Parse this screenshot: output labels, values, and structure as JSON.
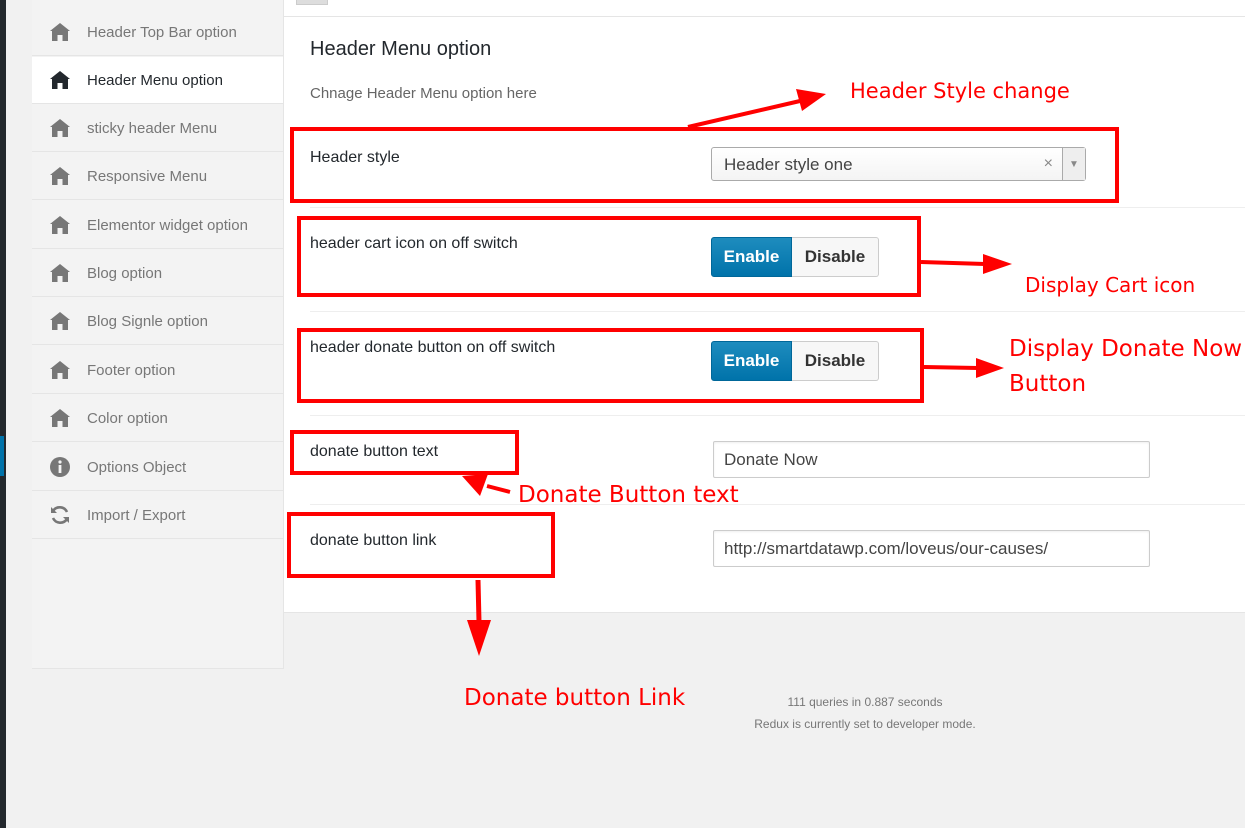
{
  "sidebar": {
    "items": [
      {
        "label": "Header Top Bar option",
        "icon": "home-icon",
        "active": false
      },
      {
        "label": "Header Menu option",
        "icon": "home-icon",
        "active": true
      },
      {
        "label": "sticky header Menu",
        "icon": "home-icon",
        "active": false
      },
      {
        "label": "Responsive Menu",
        "icon": "home-icon",
        "active": false
      },
      {
        "label": "Elementor widget option",
        "icon": "home-icon",
        "active": false
      },
      {
        "label": "Blog option",
        "icon": "home-icon",
        "active": false
      },
      {
        "label": "Blog Signle option",
        "icon": "home-icon",
        "active": false
      },
      {
        "label": "Footer option",
        "icon": "home-icon",
        "active": false
      },
      {
        "label": "Color option",
        "icon": "home-icon",
        "active": false
      },
      {
        "label": "Options Object",
        "icon": "info-icon",
        "active": false
      },
      {
        "label": "Import / Export",
        "icon": "refresh-icon",
        "active": false
      }
    ]
  },
  "section": {
    "title": "Header Menu option",
    "description": "Chnage Header Menu option here"
  },
  "fields": {
    "header_style": {
      "label": "Header style",
      "value": "Header style one",
      "clear": "×",
      "arrow": "▼"
    },
    "cart_switch": {
      "label": "header cart icon on off switch",
      "enable": "Enable",
      "disable": "Disable",
      "state": "enabled"
    },
    "donate_switch": {
      "label": "header donate button on off switch",
      "enable": "Enable",
      "disable": "Disable",
      "state": "enabled"
    },
    "donate_text": {
      "label": "donate button text",
      "value": "Donate Now"
    },
    "donate_link": {
      "label": "donate button link",
      "value": "http://smartdatawp.com/loveus/our-causes/"
    }
  },
  "annotations": {
    "header_style_change": "Header Style change",
    "display_cart_icon": "Display Cart icon",
    "display_donate_line1": "Display Donate Now",
    "display_donate_line2": "Button",
    "donate_button_text": "Donate Button text",
    "donate_button_link": "Donate button Link"
  },
  "footer": {
    "queries": "111 queries in 0.887 seconds",
    "dev_mode": "Redux is currently set to developer mode."
  },
  "colors": {
    "accent": "#0073aa",
    "annotation": "#ff0000"
  }
}
